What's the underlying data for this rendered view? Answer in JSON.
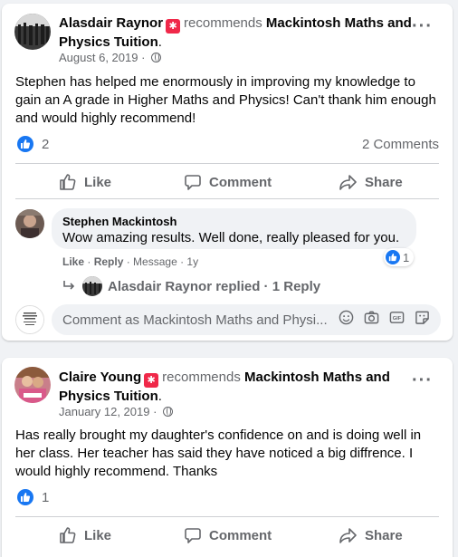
{
  "posts": [
    {
      "author": "Alasdair Raynor",
      "recommends_text": "recommends",
      "page": "Mackintosh Maths and Physics Tuition",
      "date": "August 6, 2019",
      "body": "Stephen has helped me enormously in improving my knowledge to gain an A grade in Higher Maths and Physics! Can't thank him enough and would highly recommend!",
      "likes": "2",
      "comments_count": "2 Comments",
      "actions": {
        "like": "Like",
        "comment": "Comment",
        "share": "Share"
      },
      "comment": {
        "author": "Stephen Mackintosh",
        "text": "Wow amazing results. Well done, really pleased for you.",
        "reactions": "1",
        "like": "Like",
        "reply": "Reply",
        "message": "Message",
        "age": "1y",
        "replied_text": "Alasdair Raynor replied · 1 Reply"
      },
      "compose_placeholder": "Comment as Mackintosh Maths and Physi..."
    },
    {
      "author": "Claire Young",
      "recommends_text": "recommends",
      "page": "Mackintosh Maths and Physics Tuition",
      "date": "January 12, 2019",
      "body": "Has really brought my daughter's confidence on and is doing well in her class. Her teacher has said they have noticed a big diffrence. I would highly recommend. Thanks",
      "likes": "1",
      "actions": {
        "like": "Like",
        "comment": "Comment",
        "share": "Share"
      }
    }
  ],
  "colors": {
    "accent": "#1877f2",
    "star": "#f02849",
    "secondary_text": "#65676b"
  },
  "icons": [
    "recommend-star-icon",
    "globe-icon",
    "more-icon",
    "like-icon",
    "comment-icon",
    "share-icon",
    "emoji-icon",
    "camera-icon",
    "gif-icon",
    "sticker-icon",
    "reply-arrow-icon"
  ]
}
